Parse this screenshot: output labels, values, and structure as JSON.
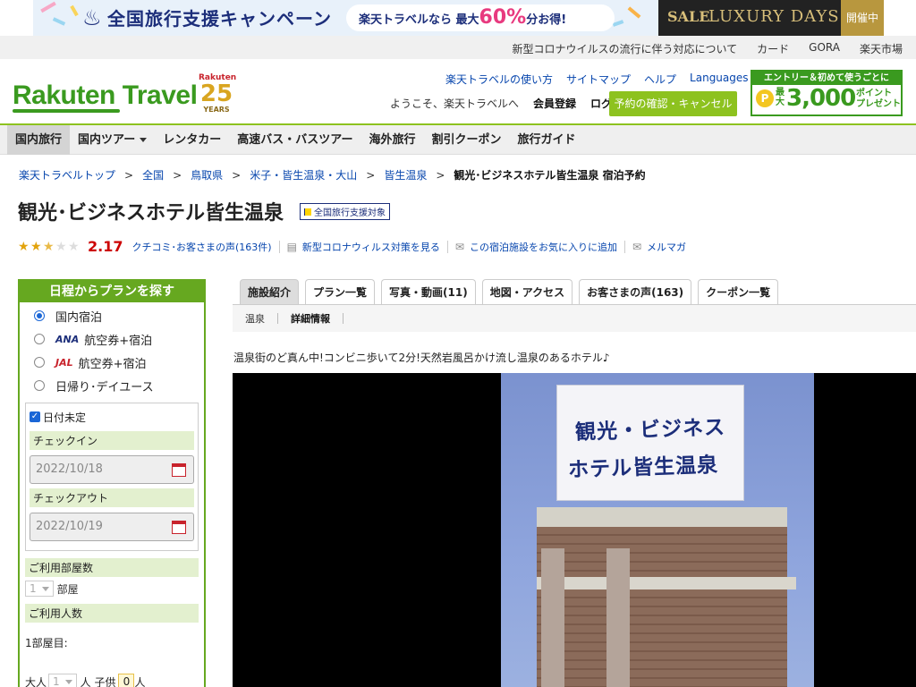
{
  "banner": {
    "campaign_title": "全国旅行支援キャンペーン",
    "campaign_prefix": "楽天トラベルなら 最大",
    "campaign_percent": "60%",
    "campaign_suffix": "分お得!",
    "luxury_sale": "SALE",
    "luxury_days": "LUXURY DAYS",
    "luxury_status": "開催中"
  },
  "topbar": {
    "links": [
      "新型コロナウイルスの流行に伴う対応について",
      "カード",
      "GORA",
      "楽天市場"
    ]
  },
  "header": {
    "logo": "Rakuten Travel",
    "anniv_brand": "Rakuten",
    "anniv_number": "25",
    "anniv_years": "YEARS",
    "nav_links": [
      "楽天トラベルの使い方",
      "サイトマップ",
      "ヘルプ",
      "Languages"
    ],
    "welcome": "ようこそ、楽天トラベルへ",
    "register": "会員登録",
    "login": "ログイン",
    "confirm_button": "予約の確認・キャンセル",
    "promo_top": "エントリー＆初めて使うごとに",
    "promo_max": "最大",
    "promo_amount": "3,000",
    "promo_points": "ポイント",
    "promo_present": "プレゼント"
  },
  "gnav": {
    "items": [
      "国内旅行",
      "国内ツアー",
      "レンタカー",
      "高速バス・バスツアー",
      "海外旅行",
      "割引クーポン",
      "旅行ガイド"
    ]
  },
  "breadcrumb": {
    "items": [
      "楽天トラベルトップ",
      "全国",
      "鳥取県",
      "米子・皆生温泉・大山",
      "皆生温泉"
    ],
    "current": "観光･ビジネスホテル皆生温泉 宿泊予約"
  },
  "hotel": {
    "name": "観光･ビジネスホテル皆生温泉",
    "support_badge": "全国旅行支援対象",
    "rating": "2.17",
    "review_link": "クチコミ･お客さまの声(163件)",
    "covid_link": "新型コロナウィルス対策を見る",
    "favorite_link": "この宿泊施設をお気に入りに追加",
    "mailmag_link": "メルマガ",
    "tagline": "温泉街のど真ん中!コンビニ歩いて2分!天然岩風呂かけ流し温泉のあるホテル♪"
  },
  "sidebar": {
    "heading": "日程からプランを探す",
    "radios": [
      "国内宿泊",
      "航空券+宿泊",
      "航空券+宿泊",
      "日帰り･デイユース"
    ],
    "ana": "ANA",
    "jal": "JAL",
    "undecided": "日付未定",
    "checkin_label": "チェックイン",
    "checkin_value": "2022/10/18",
    "checkout_label": "チェックアウト",
    "checkout_value": "2022/10/19",
    "rooms_label": "ご利用部屋数",
    "rooms_value": "1",
    "rooms_unit": "部屋",
    "people_label": "ご利用人数",
    "room1": "1部屋目:",
    "adult_label": "大人",
    "adult_value": "1",
    "adult_unit": "人 子供",
    "child_value": "0",
    "child_unit": "人"
  },
  "tabs": {
    "items": [
      "施設紹介",
      "プラン一覧",
      "写真・動画(11)",
      "地図・アクセス",
      "お客さまの声(163)",
      "クーポン一覧"
    ],
    "subtabs": [
      "温泉",
      "詳細情報"
    ]
  },
  "photo": {
    "sign_line1": "観光・ビジネス",
    "sign_line2": "ホテル皆生温泉"
  }
}
